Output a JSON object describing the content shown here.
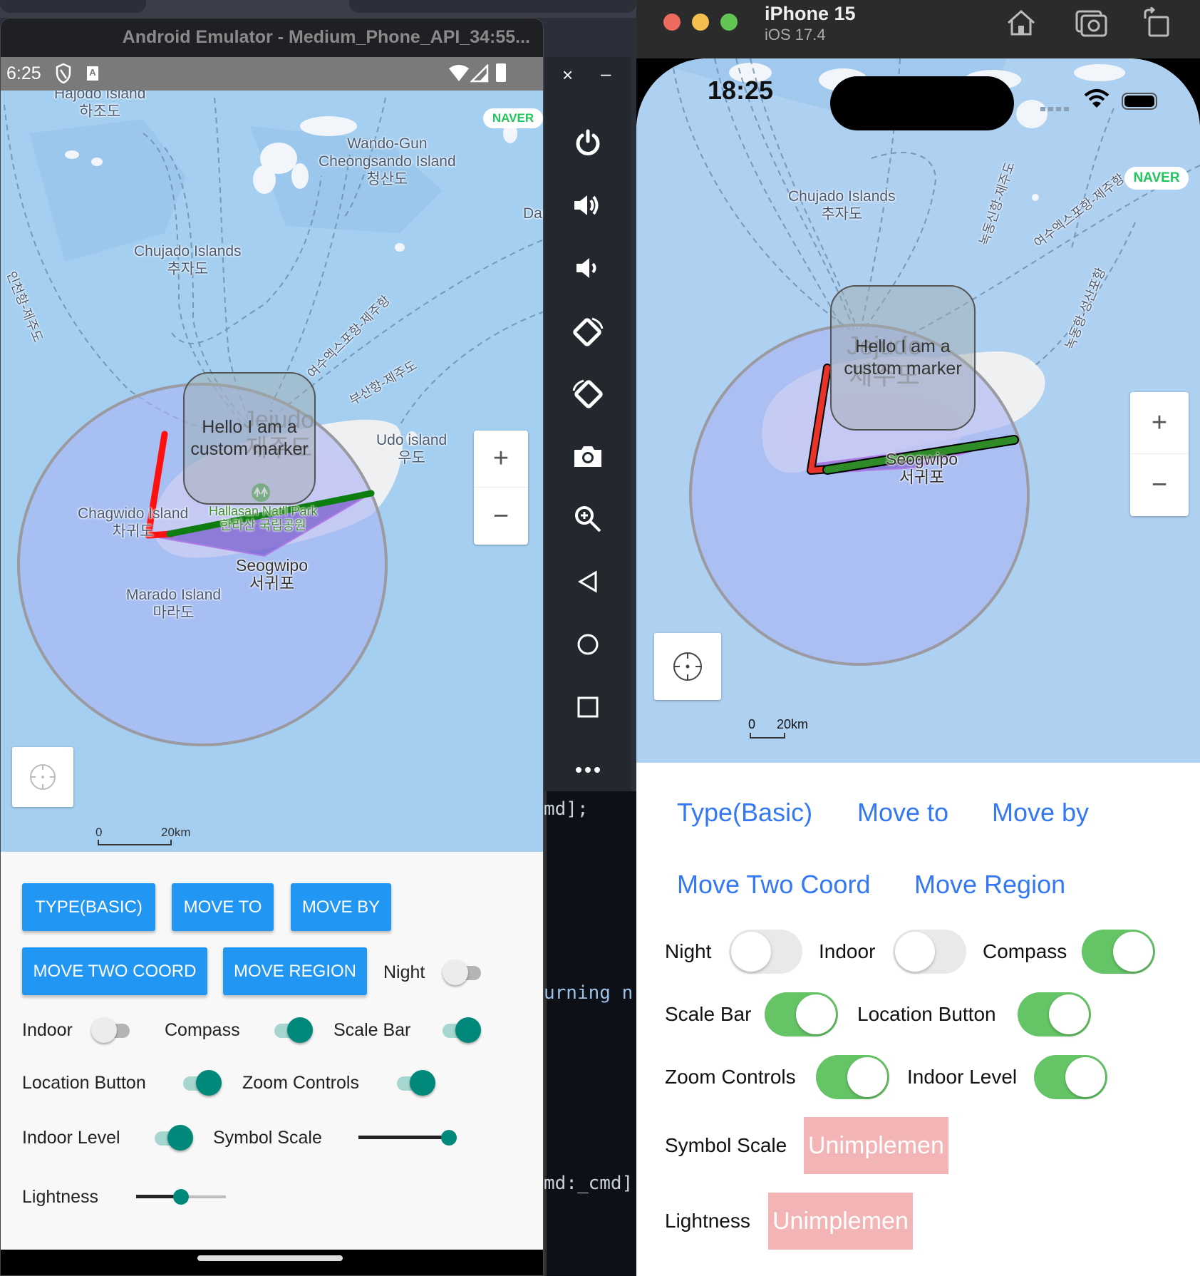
{
  "android": {
    "window_title": "Android Emulator - Medium_Phone_API_34:55...",
    "status_time": "6:25",
    "status_icons": [
      "shield-icon",
      "a-notification-icon",
      "wifi-icon",
      "signal-icon",
      "battery-icon"
    ],
    "map": {
      "naver_logo": "NAVER",
      "labels": {
        "hajodo_en": "Hajodo Island",
        "hajodo_ko": "하조도",
        "wando_en": "Wando-Gun",
        "cheongsando_en": "Cheongsando Island",
        "cheongsando_ko": "청산도",
        "dae": "Dae",
        "chujado_en": "Chujado Islands",
        "chujado_ko": "추자도",
        "route_incheon": "인천항-제주도",
        "route_yeosu": "여수엑스포항-제주항",
        "route_busan": "부산항-제주도",
        "jejudo_en": "Jejudo",
        "jejudo_ko": "제주도",
        "udo_en": "Udo island",
        "udo_ko": "우도",
        "chagwido_en": "Chagwido Island",
        "chagwido_ko": "차귀도",
        "hallasan_en": "Hallasan Nat'l Park",
        "hallasan_ko": "한라산 국립공원",
        "seogwipo_en": "Seogwipo",
        "seogwipo_ko": "서귀포",
        "marado_en": "Marado Island",
        "marado_ko": "마라도"
      },
      "marker_text_line1": "Hello I am a",
      "marker_text_line2": "custom marker",
      "zoom_in": "+",
      "zoom_out": "−",
      "scale_zero": "0",
      "scale_distance": "20km"
    },
    "buttons": [
      "TYPE(BASIC)",
      "MOVE TO",
      "MOVE BY",
      "MOVE TWO COORD",
      "MOVE REGION"
    ],
    "toggles": [
      {
        "label": "Night",
        "on": false
      },
      {
        "label": "Indoor",
        "on": false
      },
      {
        "label": "Compass",
        "on": true
      },
      {
        "label": "Scale Bar",
        "on": true
      },
      {
        "label": "Location Button",
        "on": true
      },
      {
        "label": "Zoom Controls",
        "on": true
      },
      {
        "label": "Indoor Level",
        "on": true
      }
    ],
    "sliders": [
      {
        "label": "Symbol Scale",
        "value": 1.0
      },
      {
        "label": "Lightness",
        "value": 0.5
      }
    ],
    "colors": {
      "button": "#2196f3",
      "switch_on": "#00897b",
      "map_water": "#a4cff0"
    }
  },
  "emulator_sidebar": {
    "close": "×",
    "minimize": "–",
    "tools": [
      "power-icon",
      "volume-up-icon",
      "volume-down-icon",
      "rotate-left-icon",
      "rotate-right-icon",
      "camera-icon",
      "zoom-icon",
      "back-icon",
      "home-icon",
      "overview-icon",
      "more-icon"
    ]
  },
  "code_panel": {
    "lines": [
      "md];",
      "urning n",
      "md:_cmd]"
    ]
  },
  "ios": {
    "device_name": "iPhone 15",
    "os_version": "iOS 17.4",
    "toolbar_icons": [
      "home-icon",
      "screenshot-icon",
      "rotate-icon"
    ],
    "status_time": "18:25",
    "map": {
      "naver_logo": "NAVER",
      "labels": {
        "chujado_en": "Chujado Islands",
        "chujado_ko": "추자도",
        "route_nokdong_jeju": "녹동신항-제주도",
        "route_yeosu": "여수엑스포항-제주항",
        "route_nokdong_seongsan": "녹동항-성산포항",
        "jejudo_en": "Jejudo",
        "jejudo_ko": "제주도",
        "seogwipo_en": "Seogwipo",
        "seogwipo_ko": "서귀포"
      },
      "marker_text_line1": "Hello I am a",
      "marker_text_line2": "custom marker",
      "zoom_in": "+",
      "zoom_out": "−",
      "scale_zero": "0",
      "scale_distance": "20km"
    },
    "buttons": [
      "Type(Basic)",
      "Move to",
      "Move by",
      "Move Two Coord",
      "Move Region"
    ],
    "toggles": [
      {
        "label": "Night",
        "on": false
      },
      {
        "label": "Indoor",
        "on": false
      },
      {
        "label": "Compass",
        "on": true
      },
      {
        "label": "Scale Bar",
        "on": true
      },
      {
        "label": "Location Button",
        "on": true
      },
      {
        "label": "Zoom Controls",
        "on": true
      },
      {
        "label": "Indoor Level",
        "on": true
      }
    ],
    "unimplemented": [
      {
        "label": "Symbol Scale",
        "value": "Unimplemen"
      },
      {
        "label": "Lightness",
        "value": "Unimplemen"
      }
    ],
    "colors": {
      "button_text": "#3478f6",
      "switch_on": "#65c466",
      "unimplemented_bg": "#f2b4b4"
    }
  }
}
